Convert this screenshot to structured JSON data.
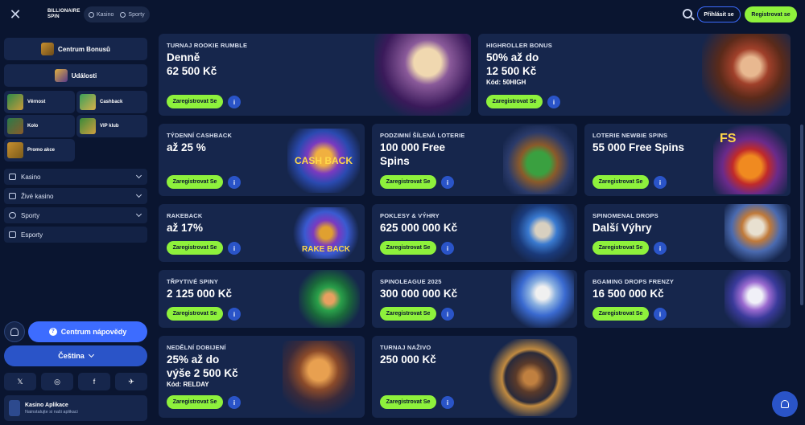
{
  "header": {
    "logo_text_1": "BILLIONAIRE",
    "logo_text_2": "SPIN",
    "tabs": [
      {
        "label": "Kasino"
      },
      {
        "label": "Sporty"
      }
    ],
    "login_label": "Přihlásit se",
    "register_label": "Registrovat se"
  },
  "sidebar": {
    "bonus_center": "Centrum Bonusů",
    "events": "Události",
    "tiles": [
      {
        "label": "Věrnost"
      },
      {
        "label": "Cashback"
      },
      {
        "label": "Kolo"
      },
      {
        "label": "VIP klub"
      },
      {
        "label": "Promo akce"
      }
    ],
    "nav": [
      {
        "label": "Kasino"
      },
      {
        "label": "Živé kasino"
      },
      {
        "label": "Sporty"
      },
      {
        "label": "Esporty"
      }
    ],
    "help_label": "Centrum nápovědy",
    "language_label": "Čeština",
    "socials": [
      "𝕏",
      "◎",
      "f",
      "✈"
    ],
    "app_title": "Kasino Aplikace",
    "app_subtitle": "Nainstalujte si naši aplikaci"
  },
  "cards": [
    {
      "label": "TURNAJ ROOKIE RUMBLE",
      "title_1": "Denně",
      "title_2": "62 500 Kč",
      "code": ""
    },
    {
      "label": "HIGHROLLER BONUS",
      "title_1": "50% až do",
      "title_2": "12 500 Kč",
      "code": "Kód: 50HIGH"
    },
    {
      "label": "TÝDENNÍ CASHBACK",
      "title_1": "až 25 %",
      "title_2": "",
      "code": ""
    },
    {
      "label": "PODZIMNÍ ŠÍLENÁ LOTERIE",
      "title_1": "100 000 Free",
      "title_2": "Spins",
      "code": ""
    },
    {
      "label": "LOTERIE NEWBIE SPINS",
      "title_1": "55 000 Free Spins",
      "title_2": "",
      "code": ""
    },
    {
      "label": "RAKEBACK",
      "title_1": "až 17%",
      "title_2": "",
      "code": ""
    },
    {
      "label": "POKLESY & VÝHRY",
      "title_1": "625 000 000 Kč",
      "title_2": "",
      "code": ""
    },
    {
      "label": "SPINOMENAL DROPS",
      "title_1": "Další Výhry",
      "title_2": "",
      "code": ""
    },
    {
      "label": "TŘPYTIVÉ SPINY",
      "title_1": "2 125 000 Kč",
      "title_2": "",
      "code": ""
    },
    {
      "label": "SPINOLEAGUE 2025",
      "title_1": "300 000 000 Kč",
      "title_2": "",
      "code": ""
    },
    {
      "label": "BGAMING DROPS FRENZY",
      "title_1": "16 500 000 Kč",
      "title_2": "",
      "code": ""
    },
    {
      "label": "NEDĚLNÍ DOBIJENÍ",
      "title_1": "25% až do",
      "title_2": "výše 2 500 Kč",
      "code": "Kód: RELDAY"
    },
    {
      "label": "TURNAJ NAŽIVO",
      "title_1": "250 000 Kč",
      "title_2": "",
      "code": ""
    }
  ],
  "card_button_label": "Zaregistrovat Se",
  "info_glyph": "i",
  "art_text": {
    "cashback": "CASH BACK",
    "rakeback": "RAKE BACK",
    "fs": "FS"
  },
  "colors": {
    "accent_green": "#8ef13c",
    "accent_blue": "#3d6cff",
    "card_bg": "#16264c",
    "page_bg": "#0a1530"
  }
}
